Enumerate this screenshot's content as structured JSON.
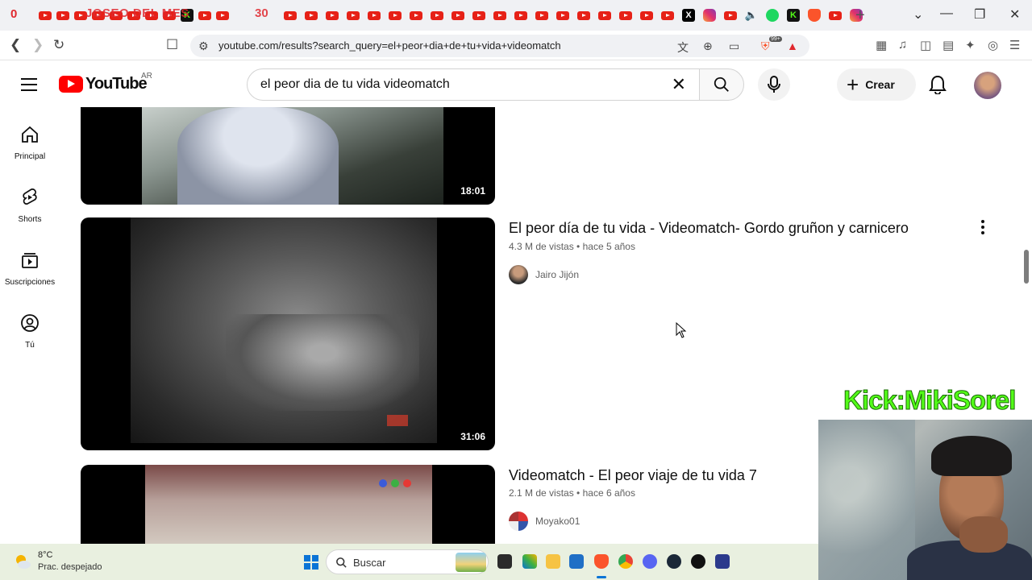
{
  "browser": {
    "tab_overlay_text": "JOSEO DEL MES",
    "tab_overlay_left": "0",
    "tab_overlay_right": "30",
    "new_tab": "+",
    "shield_badge": "99+",
    "url": "youtube.com/results?search_query=el+peor+dia+de+tu+vida+videomatch"
  },
  "header": {
    "logo_text": "YouTube",
    "country_code": "AR",
    "search_value": "el peor dia de tu vida videomatch",
    "create_label": "Crear"
  },
  "sidebar": {
    "items": [
      {
        "label": "Principal"
      },
      {
        "label": "Shorts"
      },
      {
        "label": "Suscripciones"
      },
      {
        "label": "Tú"
      }
    ]
  },
  "results": [
    {
      "duration": "18:01"
    },
    {
      "title": "El peor día de tu vida - Videomatch- Gordo gruñon y carnicero",
      "views": "4.3 M de vistas",
      "age": "hace 5 años",
      "channel": "Jairo Jijón",
      "duration": "31:06"
    },
    {
      "title": "Videomatch - El peor viaje de tu vida 7",
      "views": "2.1 M de vistas",
      "age": "hace 6 años",
      "channel": "Moyako01"
    }
  ],
  "overlay": {
    "stream_label": "Kick:MikiSorel"
  },
  "taskbar": {
    "temperature": "8°C",
    "weather": "Prac. despejado",
    "search_label": "Buscar"
  },
  "colors": {
    "youtube_red": "#ff0000",
    "kick_green": "#53fc18",
    "taskbar_bg": "#e9f0e0"
  }
}
